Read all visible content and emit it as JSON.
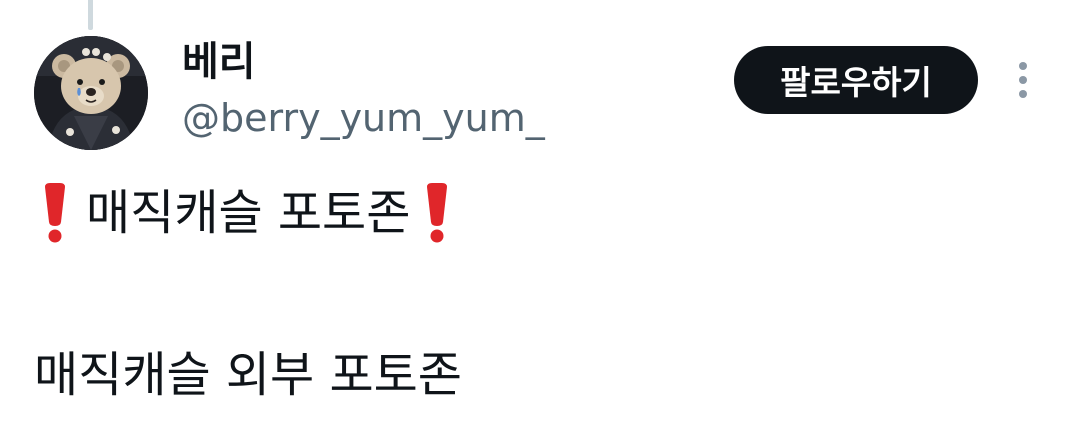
{
  "user": {
    "display_name": "베리",
    "handle": "@berry_yum_yum_",
    "avatar_icon": "teddy-bear-avatar"
  },
  "follow_button": {
    "label": "팔로우하기"
  },
  "more_icon": "more-vertical-icon",
  "tweet": {
    "line1_text": "매직캐슬 포토존",
    "line1_emoji": "red-exclamation-mark",
    "line2_text": "매직캐슬 외부 포토존"
  },
  "colors": {
    "text": "#0f1419",
    "secondary_text": "#536471",
    "button_bg": "#0f1419",
    "button_text": "#ffffff",
    "exclamation": "#e0262a",
    "thread_line": "#cfd9de"
  }
}
